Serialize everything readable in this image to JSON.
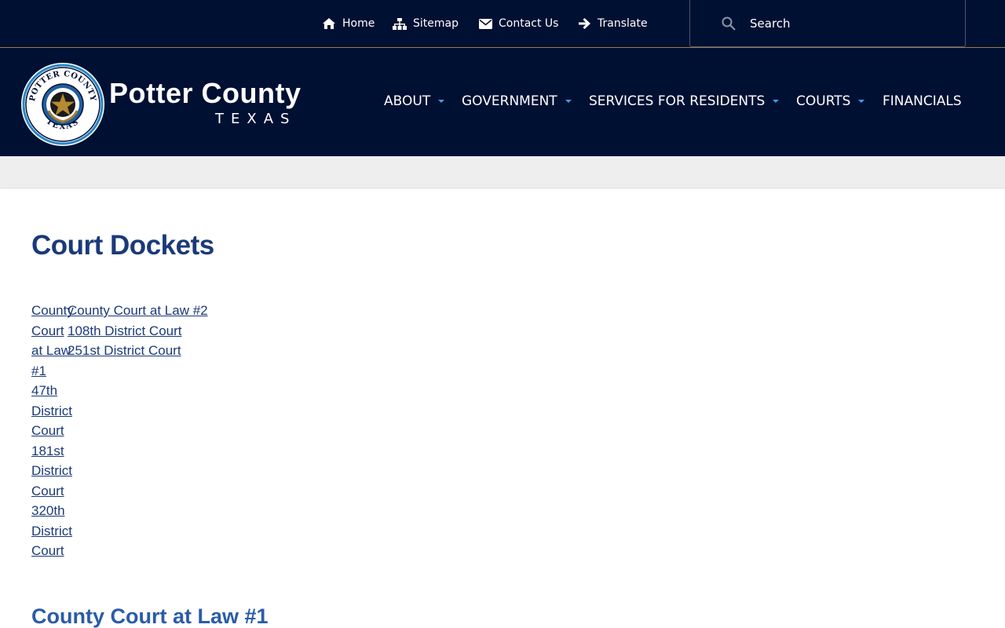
{
  "utility_nav": {
    "home": "Home",
    "sitemap": "Sitemap",
    "contact": "Contact Us",
    "translate": "Translate"
  },
  "search": {
    "placeholder": "Search"
  },
  "brand": {
    "title": "Potter County",
    "subtitle": "TEXAS",
    "seal_top_text": "POTTER COUNTY",
    "seal_bottom_text": "TEXAS"
  },
  "main_nav": {
    "about": "ABOUT",
    "government": "GOVERNMENT",
    "services": "SERVICES FOR RESIDENTS",
    "courts": "COURTS",
    "financials": "FINANCIALS"
  },
  "page": {
    "title": "Court Dockets",
    "docket_links_col1": [
      "County Court at Law #1",
      "47th District Court",
      "181st District Court",
      "320th District Court"
    ],
    "docket_links_col2": [
      "County Court at Law #2",
      "108th District Court",
      "251st District Court"
    ],
    "section_heading": "County Court at Law #1"
  },
  "colors": {
    "header_bg": "#001033",
    "accent_gold": "#9a7d4d",
    "caret_blue": "#3aa0e6",
    "title_blue": "#1b3a7a",
    "heading_blue": "#2a5ca8",
    "band_gray": "#eeeeee"
  },
  "icons": {
    "home": "home-icon",
    "sitemap": "sitemap-icon",
    "contact": "envelope-icon",
    "translate": "arrow-right-icon",
    "search": "search-icon",
    "dropdown": "caret-down-icon"
  }
}
